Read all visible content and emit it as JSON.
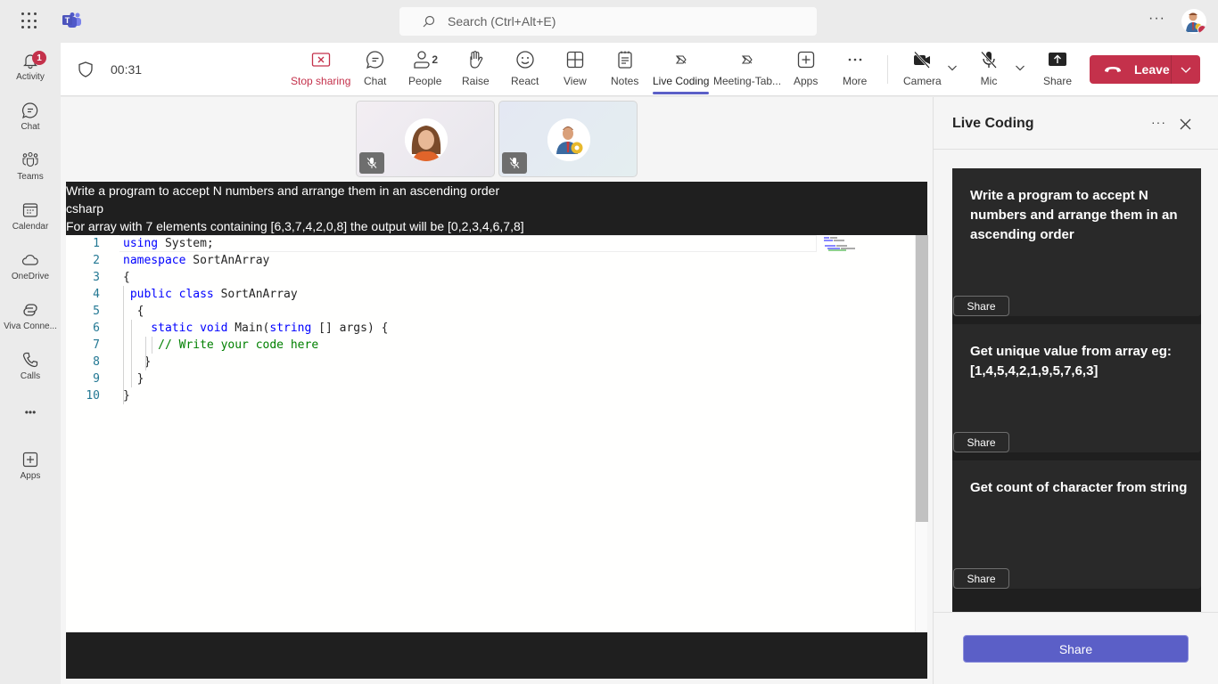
{
  "titlebar": {
    "search_placeholder": "Search (Ctrl+Alt+E)",
    "more_label": "···"
  },
  "rail": {
    "items": [
      {
        "label": "Activity",
        "icon": "bell-icon",
        "badge": "1"
      },
      {
        "label": "Chat",
        "icon": "chat-icon"
      },
      {
        "label": "Teams",
        "icon": "teams-icon"
      },
      {
        "label": "Calendar",
        "icon": "calendar-icon"
      },
      {
        "label": "OneDrive",
        "icon": "cloud-icon"
      },
      {
        "label": "Viva Conne...",
        "icon": "viva-icon"
      },
      {
        "label": "Calls",
        "icon": "phone-icon"
      },
      {
        "label": "•••",
        "icon": "more-icon"
      },
      {
        "label": "Apps",
        "icon": "apps-icon"
      }
    ]
  },
  "meeting": {
    "timer": "00:31",
    "toolbar": {
      "stop_sharing": "Stop sharing",
      "chat": "Chat",
      "people": "People",
      "people_count": "2",
      "raise": "Raise",
      "react": "React",
      "view": "View",
      "notes": "Notes",
      "live_coding": "Live Coding",
      "meeting_tab": "Meeting-Tab...",
      "apps": "Apps",
      "more": "More",
      "camera": "Camera",
      "mic": "Mic",
      "share": "Share",
      "leave": "Leave"
    },
    "accent_color": "#5b5fc7",
    "leave_color": "#c4314b"
  },
  "stage": {
    "problem": {
      "title": "Write a program to accept N numbers and arrange them in an ascending order",
      "language": "csharp",
      "example": "For array with 7 elements containing [6,3,7,4,2,0,8] the output will be [0,2,3,4,6,7,8]"
    },
    "code_lines": [
      {
        "n": "1",
        "parts": [
          [
            "kw",
            "using"
          ],
          [
            "",
            "System;"
          ]
        ]
      },
      {
        "n": "2",
        "parts": [
          [
            "kw",
            "namespace"
          ],
          [
            "",
            "SortAnArray"
          ]
        ]
      },
      {
        "n": "3",
        "parts": [
          [
            "",
            "{"
          ]
        ]
      },
      {
        "n": "4",
        "parts": [
          [
            "kw",
            " public class"
          ],
          [
            "",
            "SortAnArray"
          ]
        ]
      },
      {
        "n": "5",
        "parts": [
          [
            "",
            "  {"
          ]
        ]
      },
      {
        "n": "6",
        "parts": [
          [
            "kw",
            "    static void"
          ],
          [
            "",
            "Main("
          ],
          [
            "kw",
            "string"
          ],
          [
            "",
            "[] args) {"
          ]
        ]
      },
      {
        "n": "7",
        "parts": [
          [
            "cm",
            "     // Write your code here"
          ]
        ]
      },
      {
        "n": "8",
        "parts": [
          [
            "",
            "   }"
          ]
        ]
      },
      {
        "n": "9",
        "parts": [
          [
            "",
            "  }"
          ]
        ]
      },
      {
        "n": "10",
        "parts": [
          [
            "",
            "}"
          ]
        ]
      }
    ]
  },
  "panel": {
    "title": "Live Coding",
    "more_label": "···",
    "questions": [
      {
        "text": "Write a program to accept N numbers and arrange them in an ascending order",
        "share_label": "Share"
      },
      {
        "text": "Get unique value from array eg: [1,4,5,4,2,1,9,5,7,6,3]",
        "share_label": "Share"
      },
      {
        "text": "Get count of character from string",
        "share_label": "Share"
      }
    ],
    "share_button": "Share"
  }
}
